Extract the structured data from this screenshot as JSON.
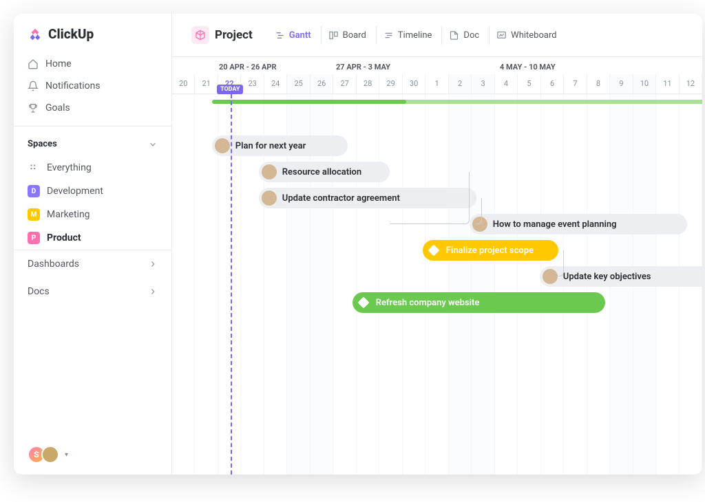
{
  "brand": {
    "name": "ClickUp"
  },
  "nav": {
    "home": "Home",
    "notifications": "Notifications",
    "goals": "Goals"
  },
  "spaces": {
    "header": "Spaces",
    "everything": "Everything",
    "items": [
      {
        "letter": "D",
        "label": "Development",
        "color": "#8a77ff"
      },
      {
        "letter": "M",
        "label": "Marketing",
        "color": "#ffc800"
      },
      {
        "letter": "P",
        "label": "Product",
        "color": "#fd71af"
      }
    ]
  },
  "sections": {
    "dashboards": "Dashboards",
    "docs": "Docs"
  },
  "footer": {
    "user_initial": "S"
  },
  "topbar": {
    "project_label": "Project",
    "views": {
      "gantt": "Gantt",
      "board": "Board",
      "timeline": "Timeline",
      "doc": "Doc",
      "whiteboard": "Whiteboard"
    }
  },
  "timeline": {
    "today_label": "TODAY",
    "ranges": [
      {
        "label": "20 APR - 26 APR",
        "span": 7
      },
      {
        "label": "27 APR - 3 MAY",
        "span": 7
      },
      {
        "label": "4 MAY - 10 MAY",
        "span": 7
      }
    ],
    "days": [
      {
        "n": "20",
        "weekend": false
      },
      {
        "n": "21",
        "weekend": false
      },
      {
        "n": "22",
        "weekend": false,
        "today": true
      },
      {
        "n": "23",
        "weekend": false
      },
      {
        "n": "24",
        "weekend": false
      },
      {
        "n": "25",
        "weekend": true
      },
      {
        "n": "26",
        "weekend": true
      },
      {
        "n": "27",
        "weekend": false
      },
      {
        "n": "28",
        "weekend": false
      },
      {
        "n": "29",
        "weekend": false
      },
      {
        "n": "30",
        "weekend": false
      },
      {
        "n": "1",
        "weekend": false
      },
      {
        "n": "2",
        "weekend": true
      },
      {
        "n": "3",
        "weekend": true
      },
      {
        "n": "4",
        "weekend": false
      },
      {
        "n": "5",
        "weekend": false
      },
      {
        "n": "6",
        "weekend": false
      },
      {
        "n": "7",
        "weekend": false
      },
      {
        "n": "8",
        "weekend": false
      },
      {
        "n": "9",
        "weekend": true
      },
      {
        "n": "10",
        "weekend": true
      },
      {
        "n": "11",
        "weekend": false
      },
      {
        "n": "12",
        "weekend": false
      }
    ],
    "today_index": 2,
    "summary": {
      "start_index": 1.7,
      "end_index": 23,
      "progress_index": 10
    },
    "tasks": [
      {
        "label": "Plan for next year",
        "style": "grey",
        "icon": "avatar",
        "start": 1.7,
        "end": 7.5,
        "row": 0
      },
      {
        "label": "Resource allocation",
        "style": "grey",
        "icon": "avatar",
        "start": 3.7,
        "end": 9.3,
        "row": 1
      },
      {
        "label": "Update contractor agreement",
        "style": "grey",
        "icon": "avatar",
        "start": 3.7,
        "end": 13,
        "row": 2
      },
      {
        "label": "How to manage event planning",
        "style": "grey",
        "icon": "avatar",
        "start": 12.7,
        "end": 22,
        "row": 3
      },
      {
        "label": "Finalize project scope",
        "style": "yellow",
        "icon": "diamond",
        "start": 10.7,
        "end": 16.5,
        "row": 4
      },
      {
        "label": "Update key objectives",
        "style": "grey",
        "icon": "avatar",
        "start": 15.7,
        "end": 24,
        "row": 5
      },
      {
        "label": "Refresh company website",
        "style": "green",
        "icon": "diamond",
        "start": 7.7,
        "end": 18.5,
        "row": 6
      }
    ]
  },
  "colors": {
    "accent": "#7b68ee",
    "green": "#6bc950",
    "green_light": "#a8e098",
    "yellow": "#ffc800",
    "pink": "#fd71af"
  }
}
